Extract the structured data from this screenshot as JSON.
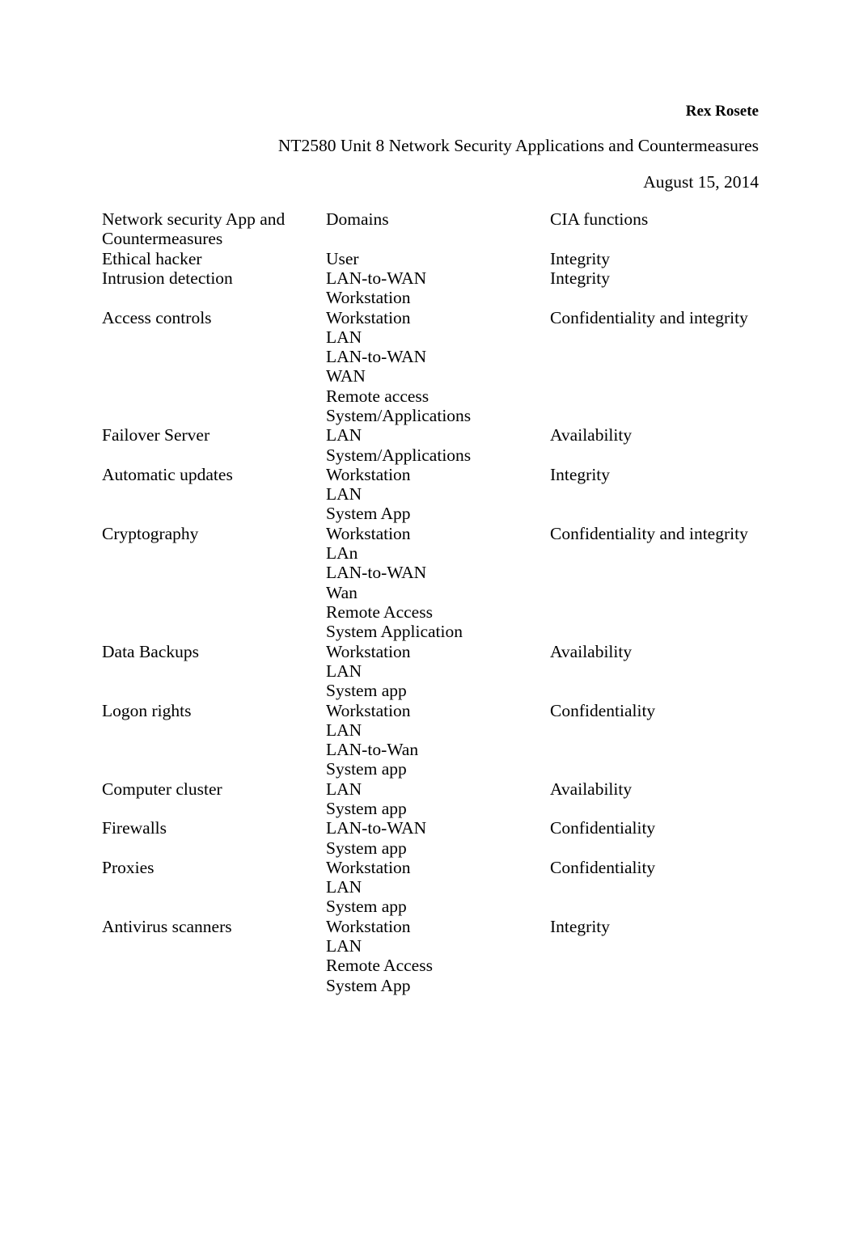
{
  "document": {
    "author": "Rex Rosete",
    "title": "NT2580 Unit 8 Network Security Applications and Countermeasures",
    "date": "August 15, 2014"
  },
  "table": {
    "headers": {
      "col1": "Network security App and\nCountermeasures",
      "col2": "Domains",
      "col3": "CIA functions"
    },
    "rows": [
      {
        "app": "Ethical hacker",
        "domains": "User",
        "cia": "Integrity"
      },
      {
        "app": "Intrusion detection",
        "domains": "LAN-to-WAN\nWorkstation",
        "cia": "Integrity"
      },
      {
        "app": "Access controls",
        "domains": "Workstation\nLAN\nLAN-to-WAN\nWAN\nRemote access\nSystem/Applications",
        "cia": "Confidentiality and integrity"
      },
      {
        "app": "Failover Server",
        "domains": "LAN\nSystem/Applications",
        "cia": "Availability"
      },
      {
        "app": "Automatic updates",
        "domains": "Workstation\nLAN\nSystem App",
        "cia": "Integrity"
      },
      {
        "app": "Cryptography",
        "domains": "Workstation\nLAn\nLAN-to-WAN\nWan\nRemote Access\nSystem Application",
        "cia": "Confidentiality and integrity"
      },
      {
        "app": "Data Backups",
        "domains": "Workstation\nLAN\nSystem app",
        "cia": "Availability"
      },
      {
        "app": "Logon rights",
        "domains": "Workstation\nLAN\nLAN-to-Wan\nSystem app",
        "cia": "Confidentiality"
      },
      {
        "app": "Computer cluster",
        "domains": "LAN\nSystem app",
        "cia": "Availability"
      },
      {
        "app": "Firewalls",
        "domains": "LAN-to-WAN\nSystem app",
        "cia": "Confidentiality"
      },
      {
        "app": "Proxies",
        "domains": "Workstation\nLAN\nSystem app",
        "cia": "Confidentiality"
      },
      {
        "app": "Antivirus scanners",
        "domains": "Workstation\nLAN\nRemote Access\nSystem App",
        "cia": "Integrity"
      }
    ]
  }
}
